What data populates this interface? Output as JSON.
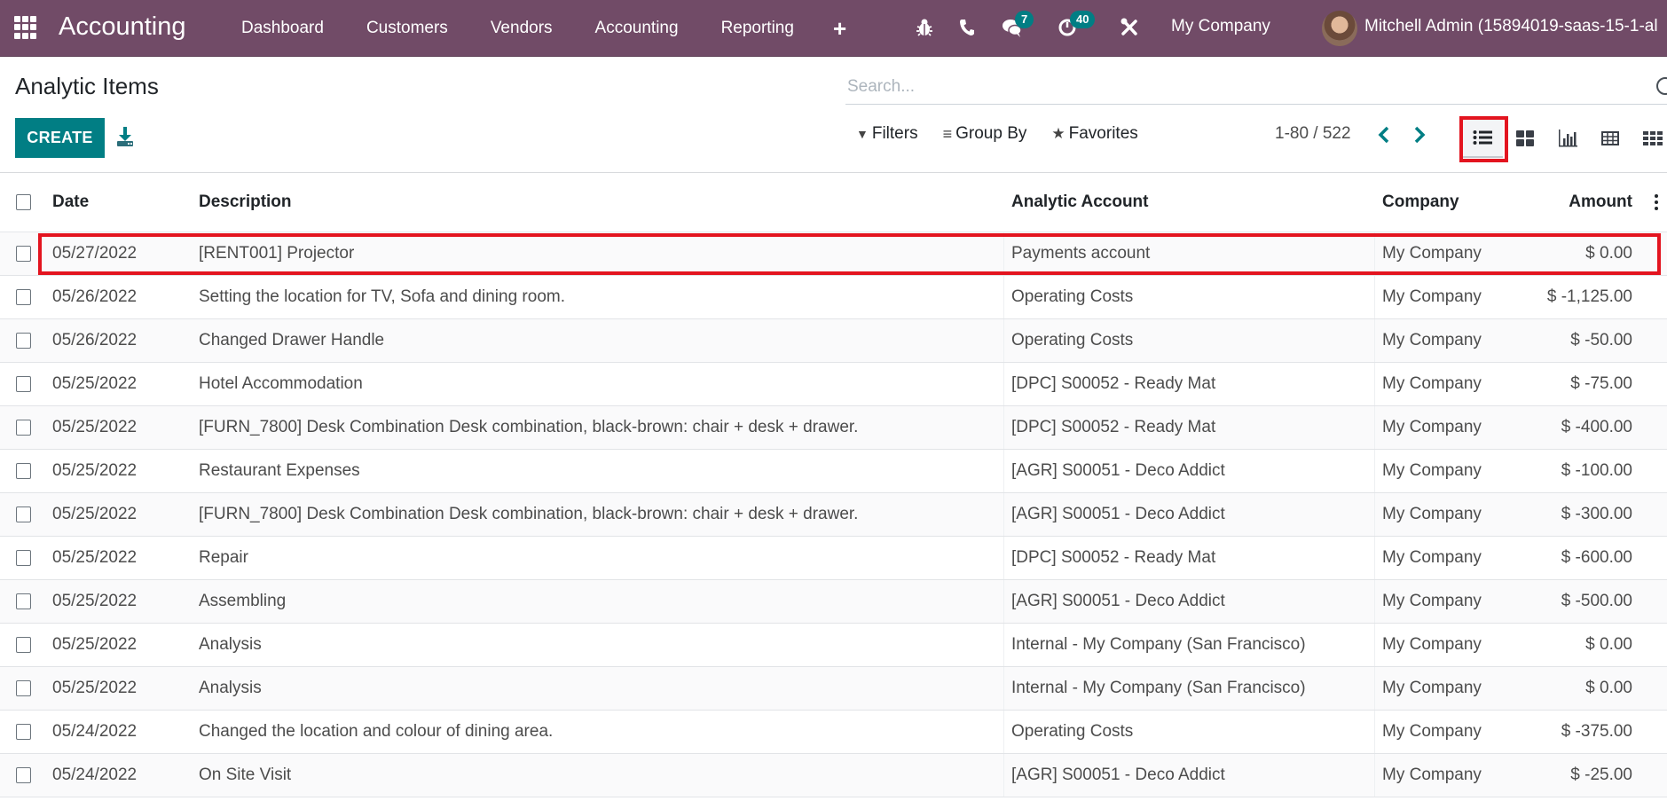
{
  "navbar": {
    "app_name": "Accounting",
    "menu": [
      "Dashboard",
      "Customers",
      "Vendors",
      "Accounting",
      "Reporting"
    ],
    "plus_icon": "+",
    "systray": {
      "debug_icon": "bug-icon",
      "phone_icon": "phone-icon",
      "messages_badge": "7",
      "activities_badge": "40",
      "settings_icon": "tools-icon"
    },
    "company": "My Company",
    "user": "Mitchell Admin (15894019-saas-15-1-al"
  },
  "control_panel": {
    "title": "Analytic Items",
    "create_label": "CREATE",
    "search_placeholder": "Search...",
    "filters_label": "Filters",
    "groupby_label": "Group By",
    "favorites_label": "Favorites",
    "pager": "1-80 / 522",
    "views": [
      "list",
      "kanban",
      "graph",
      "pivot",
      "grid"
    ],
    "active_view": "list"
  },
  "table": {
    "columns": [
      "Date",
      "Description",
      "Analytic Account",
      "Company",
      "Amount"
    ],
    "rows": [
      {
        "date": "05/27/2022",
        "description": "[RENT001] Projector",
        "account": "Payments account",
        "company": "My Company",
        "amount": "$ 0.00"
      },
      {
        "date": "05/26/2022",
        "description": "Setting the location for TV, Sofa and dining room.",
        "account": "Operating Costs",
        "company": "My Company",
        "amount": "$ -1,125.00"
      },
      {
        "date": "05/26/2022",
        "description": "Changed Drawer Handle",
        "account": "Operating Costs",
        "company": "My Company",
        "amount": "$ -50.00"
      },
      {
        "date": "05/25/2022",
        "description": "Hotel Accommodation",
        "account": "[DPC] S00052 - Ready Mat",
        "company": "My Company",
        "amount": "$ -75.00"
      },
      {
        "date": "05/25/2022",
        "description": "[FURN_7800] Desk Combination Desk combination, black-brown: chair + desk + drawer.",
        "account": "[DPC] S00052 - Ready Mat",
        "company": "My Company",
        "amount": "$ -400.00"
      },
      {
        "date": "05/25/2022",
        "description": "Restaurant Expenses",
        "account": "[AGR] S00051 - Deco Addict",
        "company": "My Company",
        "amount": "$ -100.00"
      },
      {
        "date": "05/25/2022",
        "description": "[FURN_7800] Desk Combination Desk combination, black-brown: chair + desk + drawer.",
        "account": "[AGR] S00051 - Deco Addict",
        "company": "My Company",
        "amount": "$ -300.00"
      },
      {
        "date": "05/25/2022",
        "description": "Repair",
        "account": "[DPC] S00052 - Ready Mat",
        "company": "My Company",
        "amount": "$ -600.00"
      },
      {
        "date": "05/25/2022",
        "description": "Assembling",
        "account": "[AGR] S00051 - Deco Addict",
        "company": "My Company",
        "amount": "$ -500.00"
      },
      {
        "date": "05/25/2022",
        "description": "Analysis",
        "account": "Internal - My Company (San Francisco)",
        "company": "My Company",
        "amount": "$ 0.00"
      },
      {
        "date": "05/25/2022",
        "description": "Analysis",
        "account": "Internal - My Company (San Francisco)",
        "company": "My Company",
        "amount": "$ 0.00"
      },
      {
        "date": "05/24/2022",
        "description": "Changed the location and colour of dining area.",
        "account": "Operating Costs",
        "company": "My Company",
        "amount": "$ -375.00"
      },
      {
        "date": "05/24/2022",
        "description": "On Site Visit",
        "account": "[AGR] S00051 - Deco Addict",
        "company": "My Company",
        "amount": "$ -25.00"
      }
    ]
  },
  "colors": {
    "navbar": "#714b67",
    "primary": "#017e84",
    "highlight": "#e3141f"
  }
}
